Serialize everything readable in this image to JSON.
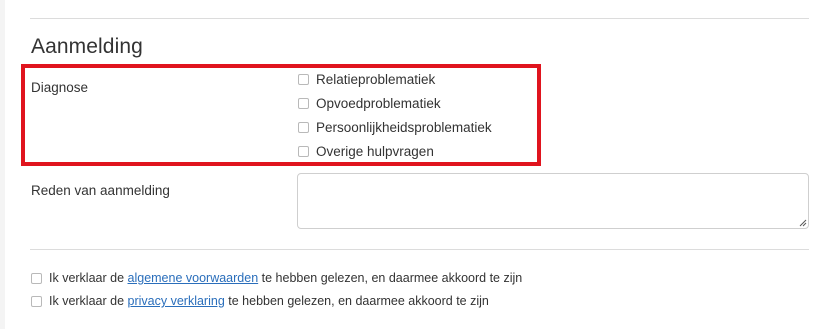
{
  "section": {
    "title": "Aanmelding"
  },
  "diagnose": {
    "label": "Diagnose",
    "options": [
      {
        "label": "Relatieproblematiek",
        "checked": false
      },
      {
        "label": "Opvoedproblematiek",
        "checked": false
      },
      {
        "label": "Persoonlijkheidsproblematiek",
        "checked": false
      },
      {
        "label": "Overige hulpvragen",
        "checked": false
      }
    ]
  },
  "reason": {
    "label": "Reden van aanmelding",
    "value": ""
  },
  "consent": [
    {
      "prefix": "Ik verklaar de",
      "link": "algemene voorwaarden",
      "suffix": "te hebben gelezen, en daarmee akkoord te zijn",
      "checked": false
    },
    {
      "prefix": "Ik verklaar de",
      "link": "privacy verklaring",
      "suffix": "te hebben gelezen, en daarmee akkoord te zijn",
      "checked": false
    }
  ],
  "colors": {
    "highlight": "#e0141e",
    "link": "#2a6ebb",
    "text": "#333333"
  }
}
